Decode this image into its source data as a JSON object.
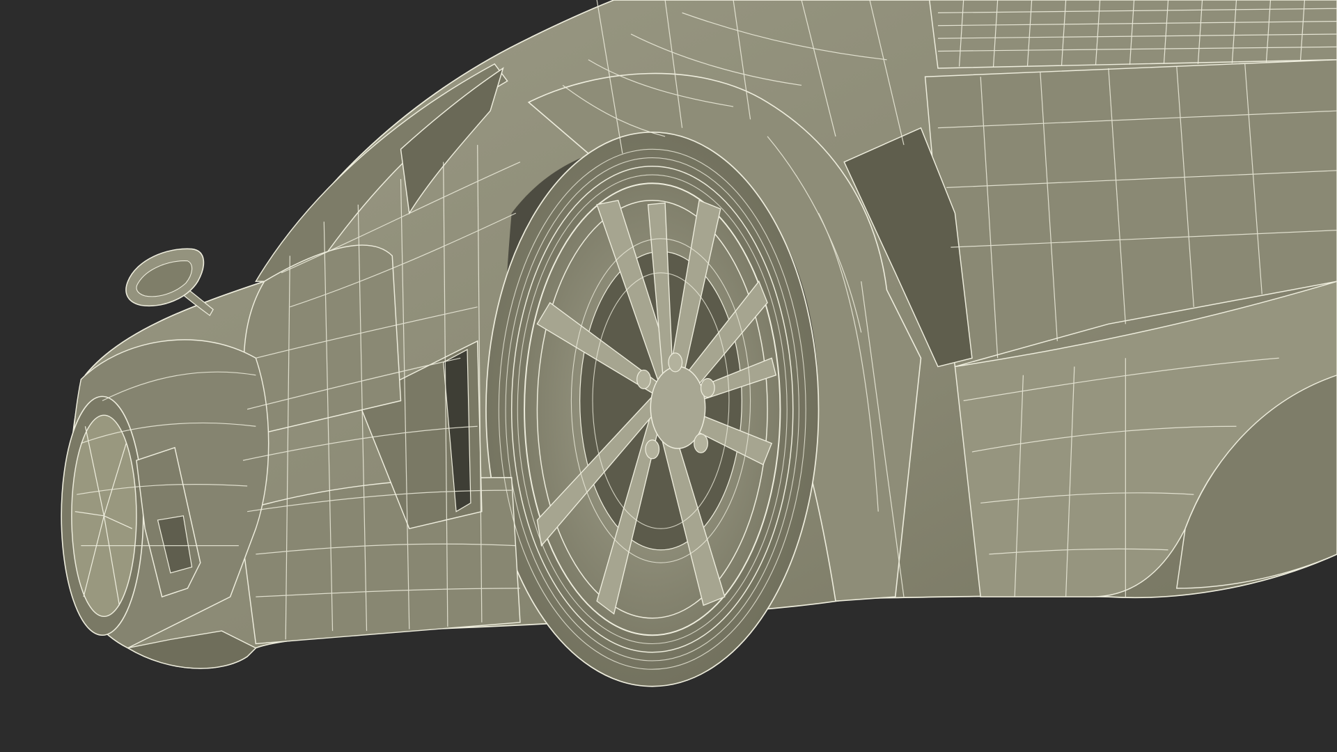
{
  "scene": {
    "subject": "car-wireframe-render",
    "colors": {
      "background": "#2c2c2c",
      "body_fill": "#8d8c77",
      "body_light": "#a09f8a",
      "body_dark": "#6d6c5b",
      "shadow": "#4a4a3f",
      "wire": "#efeede",
      "rim_fill": "#94937f",
      "void": "#3a3a32"
    }
  }
}
